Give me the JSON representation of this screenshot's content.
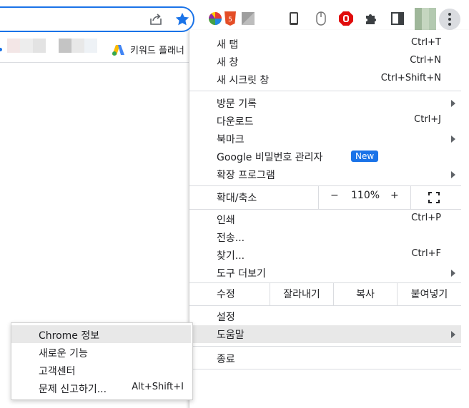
{
  "toolbar": {
    "extensions": [
      "color-wheel-icon",
      "html5-icon",
      "gray-square-icon",
      "phone-icon",
      "mouse-icon",
      "stop-icon",
      "puzzle-icon",
      "sidepanel-icon"
    ]
  },
  "bookmarks": {
    "item_label": "키워드 플래너"
  },
  "menu": {
    "items": [
      {
        "label": "새 탭",
        "shortcut": "Ctrl+T"
      },
      {
        "label": "새 창",
        "shortcut": "Ctrl+N"
      },
      {
        "label": "새 시크릿 창",
        "shortcut": "Ctrl+Shift+N"
      },
      {
        "label": "방문 기록",
        "shortcut": ""
      },
      {
        "label": "다운로드",
        "shortcut": "Ctrl+J"
      },
      {
        "label": "북마크",
        "shortcut": ""
      },
      {
        "label": "Google 비밀번호 관리자",
        "shortcut": "",
        "badge": "New"
      },
      {
        "label": "확장 프로그램",
        "shortcut": ""
      },
      {
        "label": "인쇄",
        "shortcut": "Ctrl+P"
      },
      {
        "label": "전송...",
        "shortcut": ""
      },
      {
        "label": "찾기...",
        "shortcut": "Ctrl+F"
      },
      {
        "label": "도구 더보기",
        "shortcut": ""
      },
      {
        "label": "설정",
        "shortcut": ""
      },
      {
        "label": "도움말",
        "shortcut": ""
      },
      {
        "label": "종료",
        "shortcut": ""
      }
    ],
    "zoom": {
      "label": "확대/축소",
      "minus": "−",
      "value": "110%",
      "plus": "+"
    },
    "edit": {
      "label": "수정",
      "cut": "잘라내기",
      "copy": "복사",
      "paste": "붙여넣기"
    }
  },
  "help_submenu": {
    "items": [
      {
        "label": "Chrome 정보",
        "shortcut": ""
      },
      {
        "label": "새로운 기능",
        "shortcut": ""
      },
      {
        "label": "고객센터",
        "shortcut": ""
      },
      {
        "label": "문제 신고하기...",
        "shortcut": "Alt+Shift+I"
      }
    ]
  }
}
